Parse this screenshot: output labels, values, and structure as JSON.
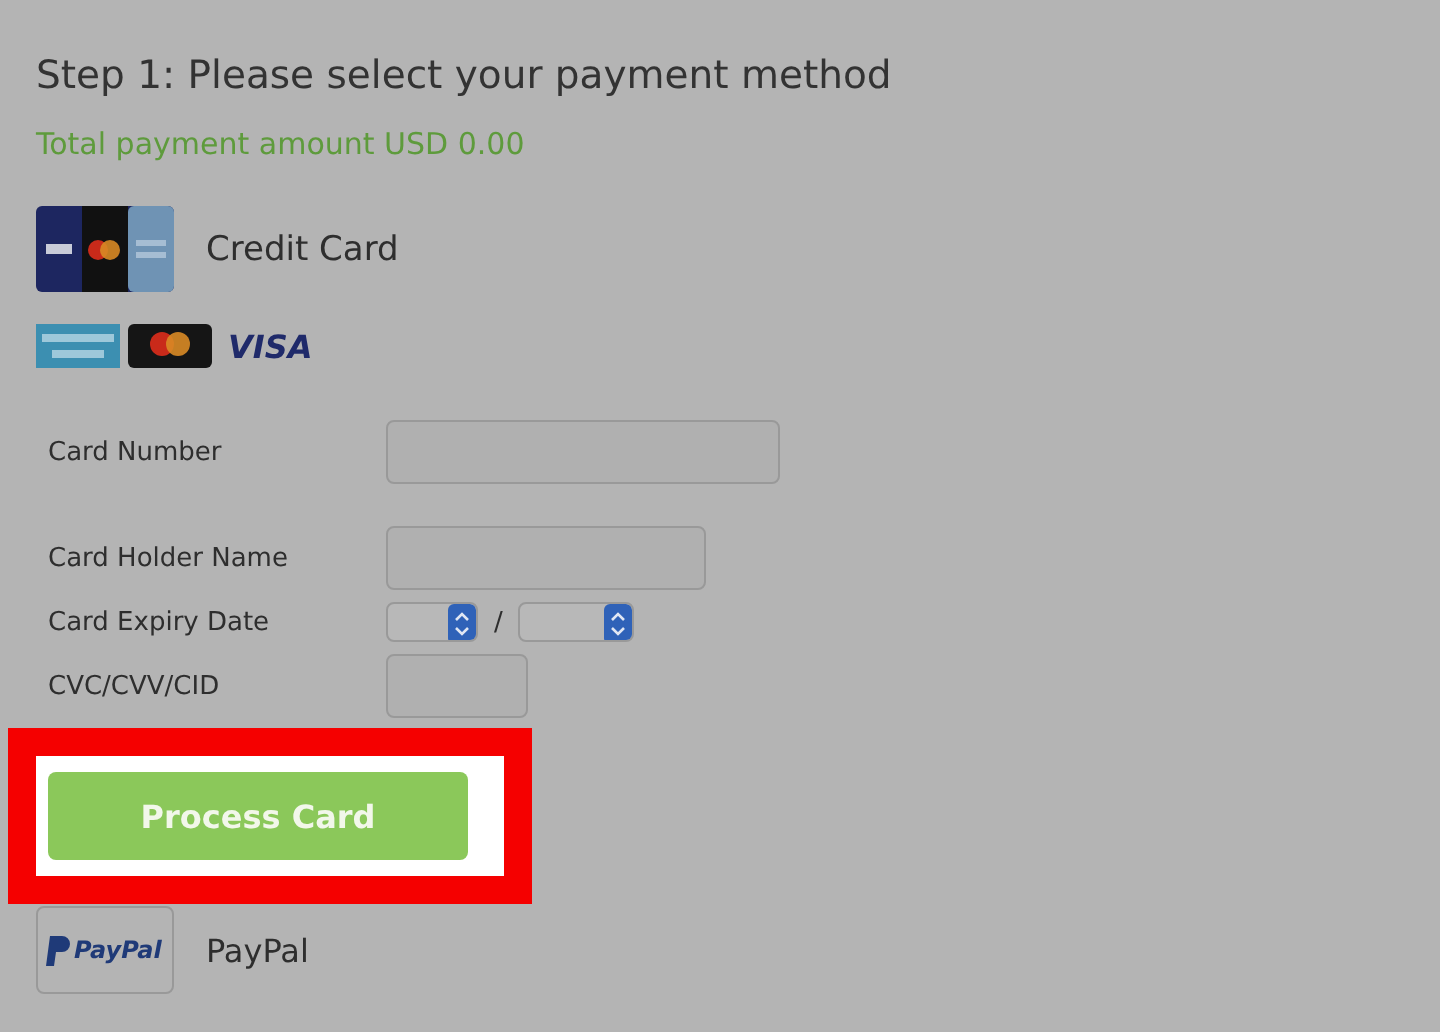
{
  "heading": "Step 1: Please select your payment method",
  "total": "Total payment amount USD 0.00",
  "credit_card": {
    "label": "Credit Card",
    "marks": [
      {
        "kind": "amex"
      },
      {
        "kind": "mastercard"
      },
      {
        "kind": "visa",
        "text": "VISA"
      }
    ]
  },
  "fields": [
    {
      "kind": "wide",
      "label": "Card Number"
    },
    {
      "kind": "medium",
      "label": "Card Holder Name"
    },
    {
      "kind": "expiry",
      "label": "Card Expiry Date",
      "separator": "/"
    },
    {
      "kind": "short",
      "label": "CVC/CVV/CID"
    }
  ],
  "submit": {
    "label": "Process Card",
    "highlighted": true
  },
  "paypal": {
    "label": "PayPal",
    "logo_text": "PayPal"
  }
}
